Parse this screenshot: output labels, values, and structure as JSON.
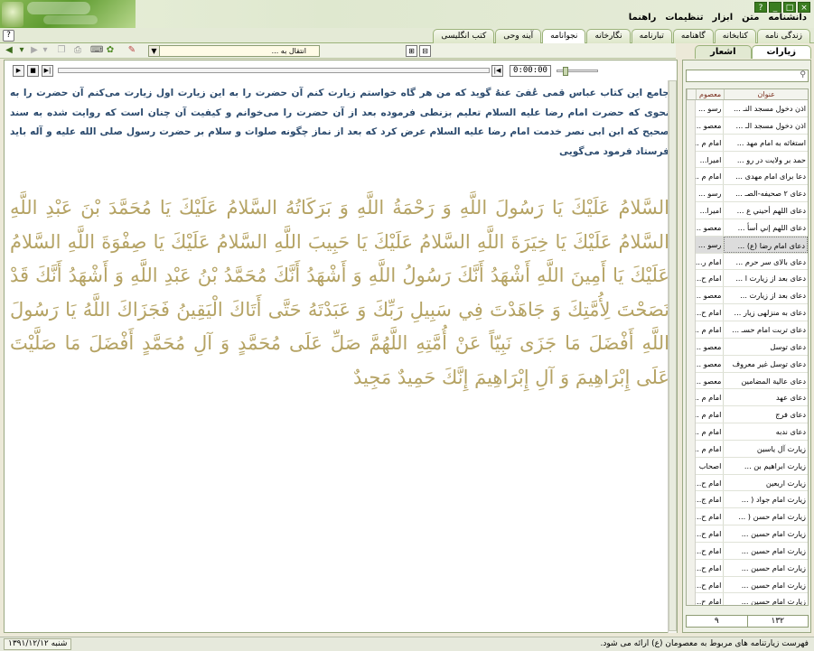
{
  "window": {
    "controls": [
      "?",
      "_",
      "□",
      "×"
    ]
  },
  "menu": [
    "دانشنامه",
    "متن",
    "ابزار",
    "تنظیمات",
    "راهنما"
  ],
  "tabs": [
    "زندگی نامه",
    "کتابخانه",
    "گاهنامه",
    "تبارنامه",
    "نگارخانه",
    "نجوانامه",
    "آینه وحی",
    "کتب انگلیسی"
  ],
  "active_tab": "نجوانامه",
  "toolbar": {
    "goto_placeholder": "انتقال به ..."
  },
  "side_tabs": [
    "زیارات",
    "اشعار"
  ],
  "active_side_tab": "زیارات",
  "player": {
    "time": "0:00:00"
  },
  "content": {
    "intro": "جامع این کتاب عباس قمی عُفیَ عنهُ گوید که من هر گاه خواستم زیارت کنم آن حضرت را به این زیارت اول زیارت می‌کنم آن حضرت را به نحوی که حضرت امام رضا علیه السلام تعلیم بزنطی فرموده بعد از آن حضرت را می‌خوانم و کیفیت آن چنان است که روایت شده به سند صحیح که ابن ابی نصر خدمت امام رضا علیه السلام عرض کرد که بعد از نماز چگونه صلوات و سلام بر حضرت رسول صلی الله علیه و آله باید فرستاد فرمود می‌گویی",
    "arabic": "السَّلامُ عَلَيْكَ يَا رَسُولَ اللَّهِ وَ رَحْمَةُ اللَّهِ وَ بَرَكَاتُهُ السَّلامُ عَلَيْكَ يَا مُحَمَّدَ بْنَ عَبْدِ اللَّهِ السَّلامُ عَلَيْكَ يَا خِيَرَةَ اللَّهِ السَّلامُ عَلَيْكَ يَا حَبِيبَ اللَّهِ السَّلامُ عَلَيْكَ يَا صِفْوَةَ اللَّهِ السَّلامُ عَلَيْكَ يَا أَمِينَ اللَّهِ أَشْهَدُ أَنَّكَ رَسُولُ اللَّهِ وَ أَشْهَدُ أَنَّكَ مُحَمَّدُ بْنُ عَبْدِ اللَّهِ وَ أَشْهَدُ أَنَّكَ قَدْ نَصَحْتَ لِأُمَّتِكَ وَ جَاهَدْتَ فِي سَبِيلِ رَبِّكَ وَ عَبَدْتَهُ حَتَّى أَتَاكَ الْيَقِينُ فَجَزَاكَ اللَّهُ يَا رَسُولَ اللَّهِ أَفْضَلَ مَا جَزَى نَبِيّاً عَنْ أُمَّتِهِ اللَّهُمَّ صَلِّ عَلَى مُحَمَّدٍ وَ آلِ مُحَمَّدٍ أَفْضَلَ مَا صَلَّيْتَ عَلَى إِبْرَاهِيمَ وَ آلِ إِبْرَاهِيمَ إِنَّكَ حَمِيدٌ مَجِيدٌ"
  },
  "list": {
    "columns": [
      "عنوان",
      "معصوم"
    ],
    "rows": [
      {
        "title": "اذن دخول مسجد النـ ...",
        "person": "رسو ..."
      },
      {
        "title": "اذن دخول مسجد الـ ...",
        "person": "معصو ..."
      },
      {
        "title": "استغاثه به امام مهد ...",
        "person": "امام م ..."
      },
      {
        "title": "حمد بر ولایت در رو ...",
        "person": "امیرا..."
      },
      {
        "title": "دعا برای امام مهدی ...",
        "person": "امام م ..."
      },
      {
        "title": "دعای ۲ صحیفه-الصـ ...",
        "person": "رسو ..."
      },
      {
        "title": "دعای اللهم أحيني ع ...",
        "person": "امیرا..."
      },
      {
        "title": "دعای اللهم إني أسأ ...",
        "person": "معصو ..."
      },
      {
        "title": "دعای امام رضا (ع) ...",
        "person": "رسو ..."
      },
      {
        "title": "دعای بالای سر حرم ...",
        "person": "امام ر..."
      },
      {
        "title": "دعای بعد از زیارت ا ...",
        "person": "امام ح..."
      },
      {
        "title": "دعای بعد از زیارت ...",
        "person": "معصو ..."
      },
      {
        "title": "دعای به منزلهی زیار ...",
        "person": "امام ح..."
      },
      {
        "title": "دعای تربت امام حسـ ...",
        "person": "امام م ..."
      },
      {
        "title": "دعای توسل",
        "person": "معصو ..."
      },
      {
        "title": "دعای توسل غیر معروف",
        "person": "معصو ..."
      },
      {
        "title": "دعای عالية المضامين",
        "person": "معصو ..."
      },
      {
        "title": "دعای عهد",
        "person": "امام م ..."
      },
      {
        "title": "دعای فرج",
        "person": "امام م ..."
      },
      {
        "title": "دعای ندبه",
        "person": "امام م ..."
      },
      {
        "title": "زیارت آل یاسین",
        "person": "امام م ..."
      },
      {
        "title": "زیارت ابراهیم بن ...",
        "person": "اصحاب"
      },
      {
        "title": "زیارت اربعین",
        "person": "امام ح..."
      },
      {
        "title": "زیارت امام جواد ( ...",
        "person": "امام ج..."
      },
      {
        "title": "زیارت امام حسن ( ...",
        "person": "امام ح..."
      },
      {
        "title": "زیارت امام حسین ...",
        "person": "امام ح..."
      },
      {
        "title": "زیارت امام حسین ...",
        "person": "امام ح..."
      },
      {
        "title": "زیارت امام حسین ...",
        "person": "امام ح..."
      },
      {
        "title": "زیارت امام حسین ...",
        "person": "امام ح..."
      },
      {
        "title": "زیارت امام حسین ...",
        "person": "امام ح..."
      }
    ],
    "selected_index": 8
  },
  "counter": {
    "total": "۱۳۲",
    "current": "۹"
  },
  "status": {
    "message": "فهرست زیارتنامه های مربوط به معصومان (ع) ارائه می شود.",
    "date": "شنبه ۱۳۹۱/۱۲/۱۲"
  },
  "colors": {
    "accent_green": "#5c9a2e",
    "intro_text": "#2c4b6e",
    "arabic_text": "#b5a364",
    "column_header": "#7a2d1c"
  }
}
